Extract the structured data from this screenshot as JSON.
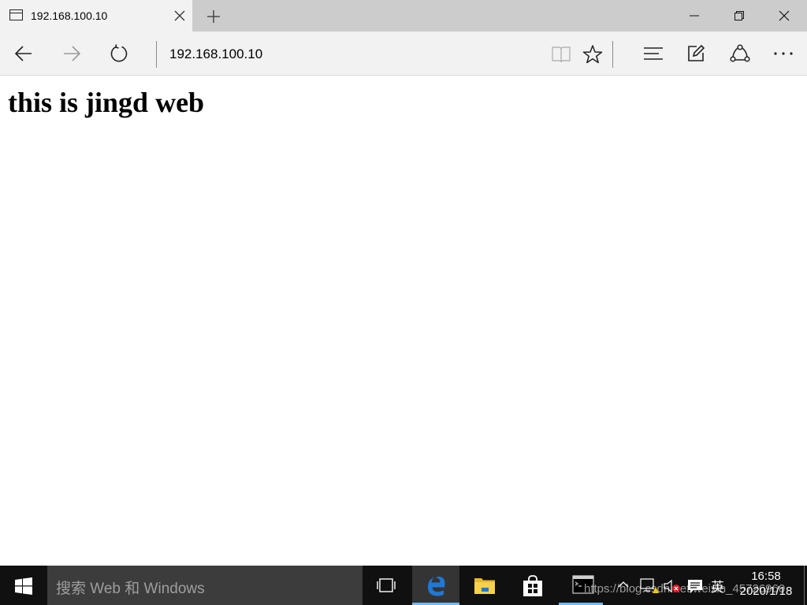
{
  "tab": {
    "title": "192.168.100.10"
  },
  "address_bar": {
    "url": "192.168.100.10"
  },
  "page": {
    "heading": "this is jingd web"
  },
  "taskbar": {
    "search_placeholder": "搜索 Web 和 Windows",
    "clock_time": "16:58",
    "clock_date": "2020/1/18",
    "ime_label": "英",
    "watermark": "https://blog.csdn.net/weixin_45726960"
  },
  "icons": {
    "back": "back-arrow-icon",
    "forward": "forward-arrow-icon",
    "refresh": "refresh-icon",
    "reading_view": "book-icon",
    "favorite": "star-icon",
    "hub": "hub-icon",
    "web_note": "pen-icon",
    "share": "share-icon",
    "more": "more-dots-icon"
  },
  "colors": {
    "tab_strip": "#cccccc",
    "chrome": "#f2f2f2",
    "taskbar": "#101010",
    "search_box": "#3c3c3c",
    "edge_blue": "#1e78d7",
    "active_indicator": "#76b9ed"
  }
}
